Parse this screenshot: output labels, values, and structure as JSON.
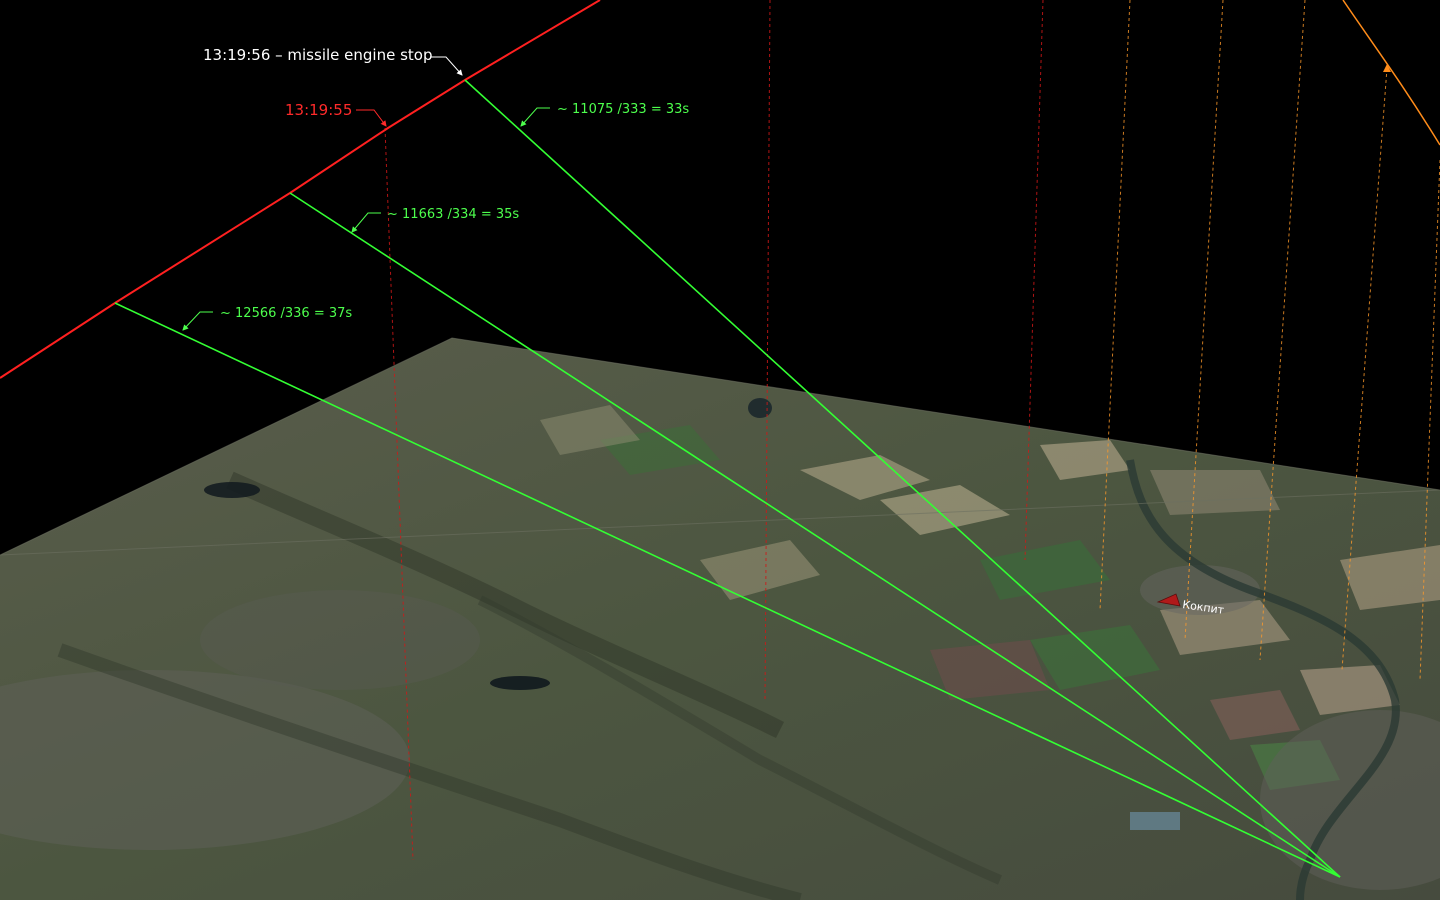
{
  "labels": {
    "engine_stop": "13:19:56 – missile engine stop",
    "time_mark": "13:19:55",
    "calc_1": "~ 11075 /333 = 33s",
    "calc_2": "~ 11663 /334 = 35s",
    "calc_3": "~ 12566 /336 = 37s",
    "place_name": "Кокпит"
  },
  "colors": {
    "background": "#000000",
    "trajectory": "#ff2020",
    "sight_lines": "#33ff33",
    "label_green": "#4dff4d",
    "label_red": "#ff2a2a",
    "drop_lines_red": "#d01818",
    "drop_lines_orange": "#ff9a2a",
    "flight_path": "#ff8c1a",
    "terrain_base": "#4d5440"
  },
  "icons": {
    "place_marker": "red-arrow-marker-icon"
  }
}
